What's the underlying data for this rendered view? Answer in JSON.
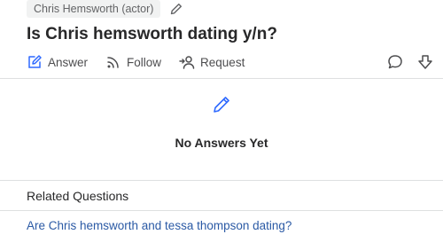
{
  "topic": {
    "label": "Chris Hemsworth (actor)",
    "edit_icon": "pencil-icon"
  },
  "question": {
    "title": "Is Chris hemsworth dating y/n?"
  },
  "actions": {
    "answer_label": "Answer",
    "follow_label": "Follow",
    "request_label": "Request",
    "comment_icon": "comment-icon",
    "downvote_icon": "downvote-icon"
  },
  "answers": {
    "empty_text": "No Answers Yet",
    "empty_icon": "pencil-icon"
  },
  "related": {
    "heading": "Related Questions",
    "items": [
      "Are Chris hemsworth and tessa thompson dating?"
    ]
  },
  "colors": {
    "accent": "#2e69ff",
    "link": "#2b5aa5",
    "divider": "#dee0e1"
  }
}
